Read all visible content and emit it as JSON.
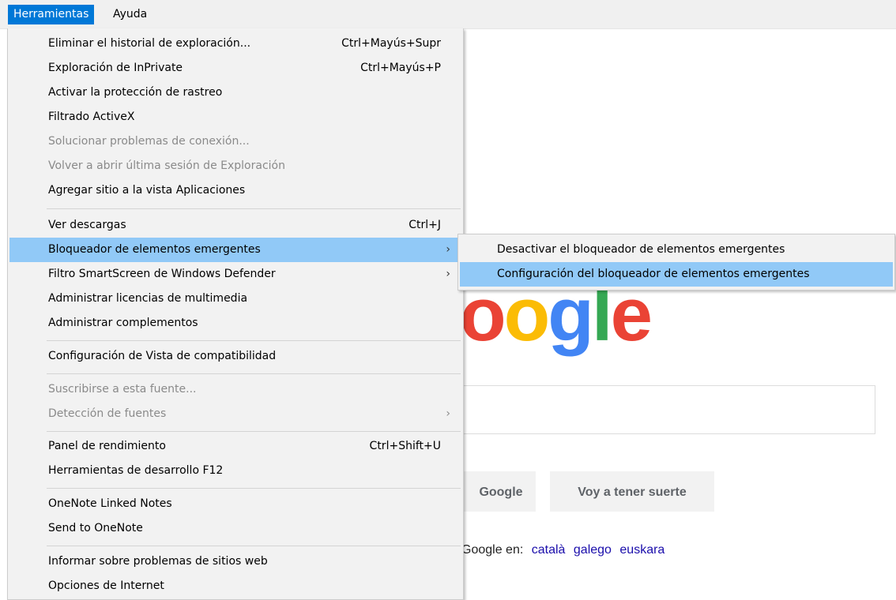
{
  "menubar": {
    "items": [
      {
        "label": "Herramientas"
      },
      {
        "label": "Ayuda"
      }
    ]
  },
  "menu": {
    "items": [
      {
        "label": "Eliminar el historial de exploración...",
        "shortcut": "Ctrl+Mayús+Supr"
      },
      {
        "label": "Exploración de InPrivate",
        "shortcut": "Ctrl+Mayús+P"
      },
      {
        "label": "Activar la protección de rastreo"
      },
      {
        "label": "Filtrado ActiveX"
      },
      {
        "label": "Solucionar problemas de conexión...",
        "disabled": true
      },
      {
        "label": "Volver a abrir última sesión de Exploración",
        "disabled": true
      },
      {
        "label": "Agregar sitio a la vista Aplicaciones"
      },
      {
        "label": "Ver descargas",
        "shortcut": "Ctrl+J"
      },
      {
        "label": "Bloqueador de elementos emergentes",
        "submenu": true,
        "highlighted": true
      },
      {
        "label": "Filtro SmartScreen de Windows Defender",
        "submenu": true
      },
      {
        "label": "Administrar licencias de multimedia"
      },
      {
        "label": "Administrar complementos"
      },
      {
        "label": "Configuración de Vista de compatibilidad"
      },
      {
        "label": "Suscribirse a esta fuente...",
        "disabled": true
      },
      {
        "label": "Detección de fuentes",
        "disabled": true,
        "submenu": true
      },
      {
        "label": "Panel de rendimiento",
        "shortcut": "Ctrl+Shift+U"
      },
      {
        "label": "Herramientas de desarrollo F12"
      },
      {
        "label": "OneNote Linked Notes"
      },
      {
        "label": "Send to OneNote"
      },
      {
        "label": "Informar sobre problemas de sitios web"
      },
      {
        "label": "Opciones de Internet"
      }
    ],
    "arrow_glyph": "›"
  },
  "submenu": {
    "items": [
      {
        "label": "Desactivar el bloqueador de elementos emergentes"
      },
      {
        "label": "Configuración del bloqueador de elementos emergentes",
        "highlighted": true
      }
    ]
  },
  "google": {
    "logo_visible_text": "oogle",
    "logo_colors": [
      "#ea4335",
      "#fbbc05",
      "#4285f4",
      "#34a853",
      "#ea4335"
    ],
    "search_button": "Google",
    "lucky_button": "Voy a tener suerte",
    "lang_prefix": "Google en:",
    "languages": [
      "català",
      "galego",
      "euskara"
    ]
  },
  "colors": {
    "menu_bg": "#f2f2f2",
    "highlight": "#91c9f7",
    "menubar_active": "#0078d7",
    "disabled_text": "#8a8a8a",
    "link": "#1a0dab"
  }
}
